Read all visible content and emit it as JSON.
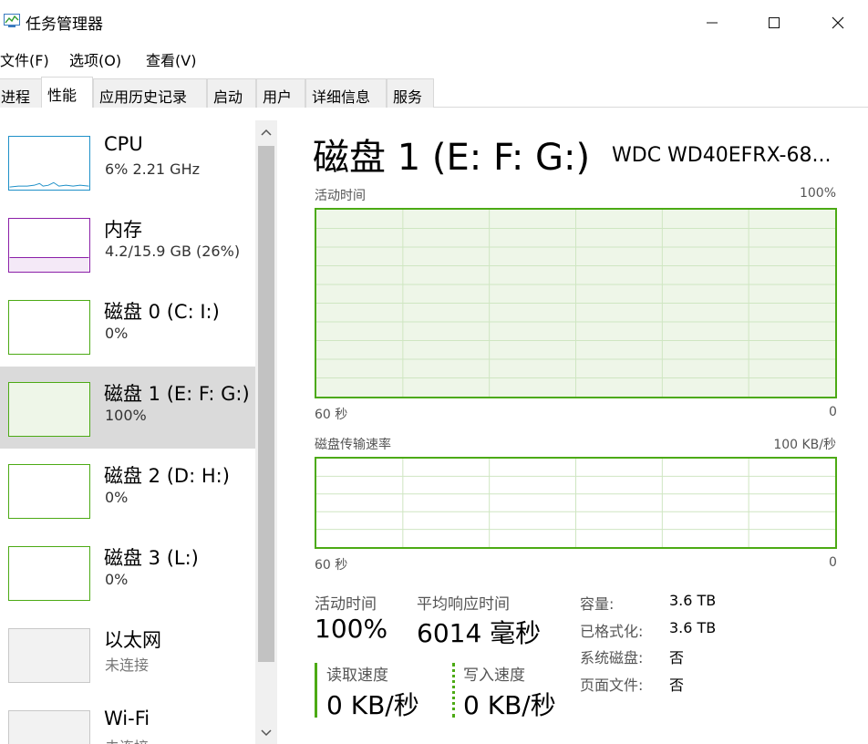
{
  "window": {
    "title": "任务管理器"
  },
  "menu": [
    "文件(F)",
    "选项(O)",
    "查看(V)"
  ],
  "tabs": [
    "进程",
    "性能",
    "应用历史记录",
    "启动",
    "用户",
    "详细信息",
    "服务"
  ],
  "resources": [
    {
      "name": "CPU",
      "sub": "6% 2.21 GHz",
      "color": "#1e90c8"
    },
    {
      "name": "内存",
      "sub": "4.2/15.9 GB (26%)",
      "color": "#8b1fa8"
    },
    {
      "name": "磁盘 0 (C: I:)",
      "sub": "0%",
      "color": "#4caa14"
    },
    {
      "name": "磁盘 1 (E: F: G:)",
      "sub": "100%",
      "color": "#4caa14"
    },
    {
      "name": "磁盘 2 (D: H:)",
      "sub": "0%",
      "color": "#4caa14"
    },
    {
      "name": "磁盘 3 (L:)",
      "sub": "0%",
      "color": "#4caa14"
    },
    {
      "name": "以太网",
      "sub": "未连接",
      "color": "#b0b0b0"
    },
    {
      "name": "Wi-Fi",
      "sub": "未连接",
      "color": "#b0b0b0"
    }
  ],
  "detail": {
    "title": "磁盘 1 (E: F: G:)",
    "model": "WDC WD40EFRX-68...",
    "chart1": {
      "label": "活动时间",
      "max": "100%",
      "left": "60 秒",
      "right": "0",
      "level": 1.0
    },
    "chart2": {
      "label": "磁盘传输速率",
      "max": "100 KB/秒",
      "left": "60 秒",
      "right": "0",
      "level": 0.0
    },
    "stats": {
      "active_label": "活动时间",
      "active_value": "100%",
      "resp_label": "平均响应时间",
      "resp_value": "6014 毫秒",
      "read_label": "读取速度",
      "read_value": "0 KB/秒",
      "write_label": "写入速度",
      "write_value": "0 KB/秒"
    },
    "info": [
      {
        "key": "容量:",
        "value": "3.6 TB"
      },
      {
        "key": "已格式化:",
        "value": "3.6 TB"
      },
      {
        "key": "系统磁盘:",
        "value": "否"
      },
      {
        "key": "页面文件:",
        "value": "否"
      }
    ]
  },
  "colors": {
    "disk": "#4caa14",
    "disk_fill": "#eef6e8",
    "cpu": "#1e90c8",
    "memory": "#8b1fa8"
  }
}
